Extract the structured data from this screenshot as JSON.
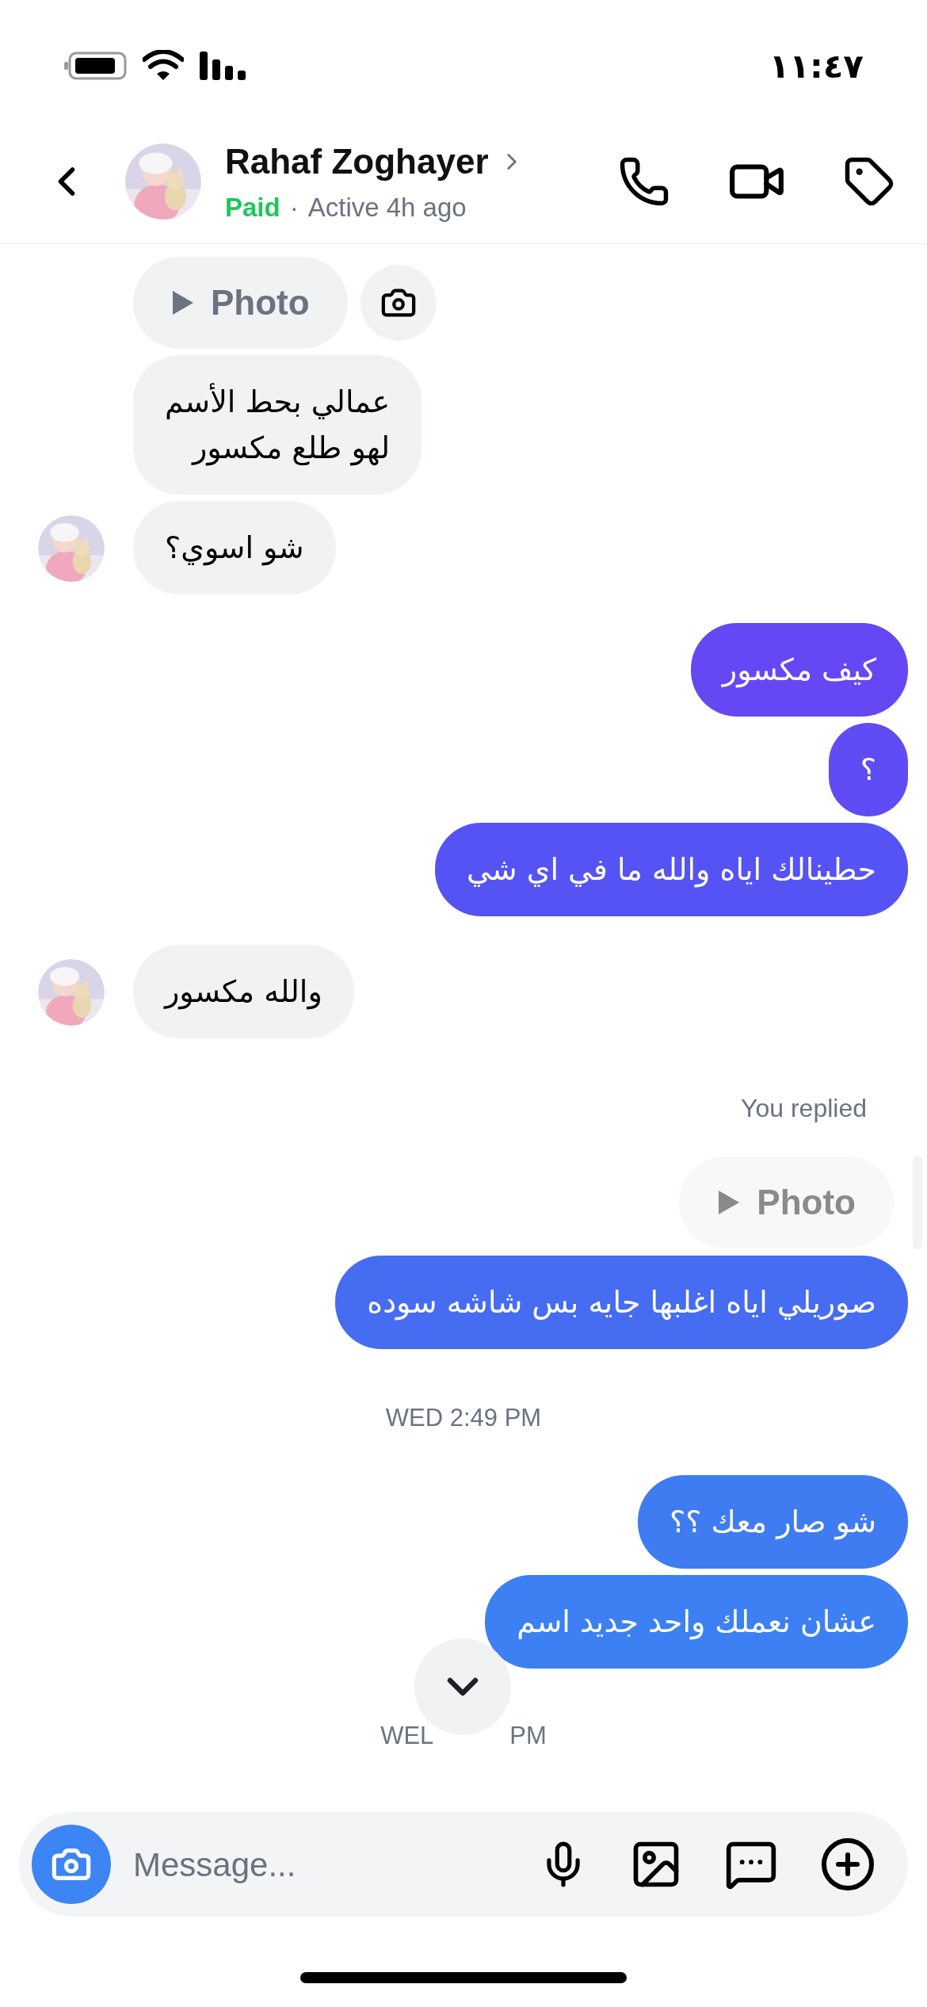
{
  "status_bar": {
    "time": "١١:٤٧"
  },
  "header": {
    "name": "Rahaf Zoghayer",
    "badge": "Paid",
    "separator": "·",
    "activity": "Active 4h ago"
  },
  "messages": [
    {
      "outgoing": false,
      "label": "Photo",
      "dimmed": false
    },
    {
      "kind": "text",
      "outgoing": false,
      "text": "عمالي بحط الأسم\nلهو طلع مكسور",
      "avatar": false
    },
    {
      "kind": "text",
      "outgoing": false,
      "text": "شو اسوي؟",
      "avatar": true
    },
    {
      "kind": "text",
      "outgoing": true,
      "text": "كيف مكسور",
      "color": "#6548f4"
    },
    {
      "kind": "text",
      "outgoing": true,
      "text": "؟",
      "color": "#604cf4"
    },
    {
      "kind": "text",
      "outgoing": true,
      "text": "حطينالك اياه والله ما في اي شي",
      "color": "#5553f3"
    },
    {
      "kind": "text",
      "outgoing": false,
      "text": "والله مكسور",
      "avatar": true
    },
    {
      "kind": "note",
      "text": "You replied"
    },
    {
      "outgoing": true,
      "label": "Photo",
      "dimmed": true
    },
    {
      "kind": "text",
      "outgoing": true,
      "text": "صوريلي اياه اغلبها جايه بس شاشه سوده",
      "color": "#466cf2"
    },
    {
      "kind": "timestamp",
      "text": "WED 2:49 PM"
    },
    {
      "kind": "text",
      "outgoing": true,
      "text": "شو صار معك ؟؟",
      "color": "#3f7cf2"
    },
    {
      "kind": "text",
      "outgoing": true,
      "text": "عشان نعملك واحد جديد اسم",
      "color": "#3c80f3"
    },
    {
      "kind": "split_timestamp",
      "left": "WEL",
      "right": "PM"
    }
  ],
  "composer": {
    "placeholder": "Message..."
  }
}
